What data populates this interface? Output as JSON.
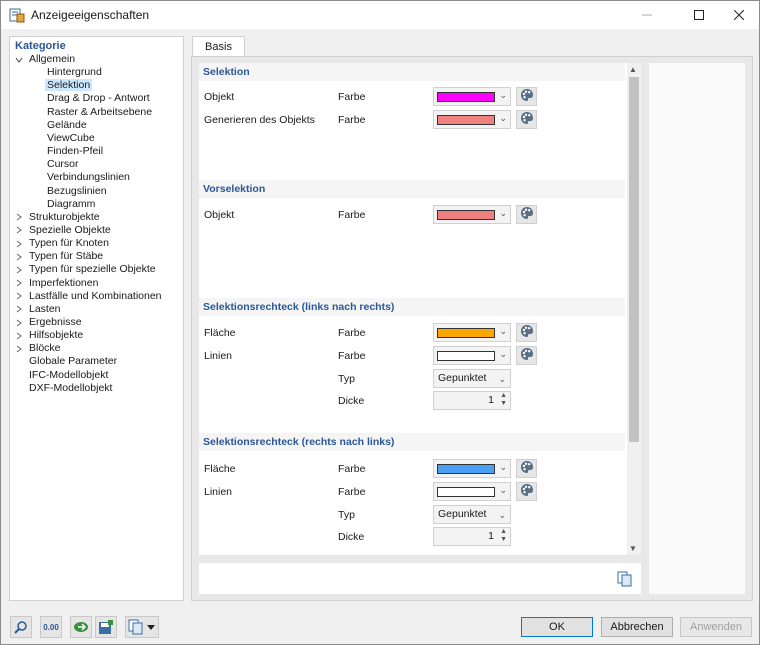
{
  "window": {
    "title": "Anzeigeeigenschaften"
  },
  "category": {
    "header": "Kategorie",
    "items": [
      {
        "label": "Allgemein",
        "level": 0,
        "expander": "open"
      },
      {
        "label": "Hintergrund",
        "level": 2
      },
      {
        "label": "Selektion",
        "level": 2,
        "selected": true
      },
      {
        "label": "Drag & Drop - Antwort",
        "level": 2
      },
      {
        "label": "Raster & Arbeitsebene",
        "level": 2
      },
      {
        "label": "Gelände",
        "level": 2
      },
      {
        "label": "ViewCube",
        "level": 2
      },
      {
        "label": "Finden-Pfeil",
        "level": 2
      },
      {
        "label": "Cursor",
        "level": 2
      },
      {
        "label": "Verbindungslinien",
        "level": 2
      },
      {
        "label": "Bezugslinien",
        "level": 2
      },
      {
        "label": "Diagramm",
        "level": 2
      },
      {
        "label": "Strukturobjekte",
        "level": 0,
        "expander": "closed"
      },
      {
        "label": "Spezielle Objekte",
        "level": 0,
        "expander": "closed"
      },
      {
        "label": "Typen für Knoten",
        "level": 0,
        "expander": "closed"
      },
      {
        "label": "Typen für Stäbe",
        "level": 0,
        "expander": "closed"
      },
      {
        "label": "Typen für spezielle Objekte",
        "level": 0,
        "expander": "closed"
      },
      {
        "label": "Imperfektionen",
        "level": 0,
        "expander": "closed"
      },
      {
        "label": "Lastfälle und Kombinationen",
        "level": 0,
        "expander": "closed"
      },
      {
        "label": "Lasten",
        "level": 0,
        "expander": "closed"
      },
      {
        "label": "Ergebnisse",
        "level": 0,
        "expander": "closed"
      },
      {
        "label": "Hilfsobjekte",
        "level": 0,
        "expander": "closed"
      },
      {
        "label": "Blöcke",
        "level": 0,
        "expander": "closed"
      },
      {
        "label": "Globale Parameter",
        "level": 0
      },
      {
        "label": "IFC-Modellobjekt",
        "level": 0
      },
      {
        "label": "DXF-Modellobjekt",
        "level": 0
      }
    ]
  },
  "tab": {
    "label": "Basis"
  },
  "sections": {
    "selektion": {
      "title": "Selektion",
      "rows": [
        {
          "label": "Objekt",
          "prop": "Farbe",
          "color": "#ff00ff"
        },
        {
          "label": "Generieren des Objekts",
          "prop": "Farbe",
          "color": "#f08080"
        }
      ]
    },
    "vorselektion": {
      "title": "Vorselektion",
      "rows": [
        {
          "label": "Objekt",
          "prop": "Farbe",
          "color": "#f08080"
        }
      ]
    },
    "rect_lr": {
      "title": "Selektionsrechteck (links nach rechts)",
      "flaeche": {
        "label": "Fläche",
        "prop": "Farbe",
        "color": "#ffa500"
      },
      "linien": {
        "label": "Linien",
        "prop": "Farbe",
        "color": "#ffffff"
      },
      "typ": {
        "label": "Typ",
        "value": "Gepunktet"
      },
      "dicke": {
        "label": "Dicke",
        "value": "1"
      }
    },
    "rect_rl": {
      "title": "Selektionsrechteck (rechts nach links)",
      "flaeche": {
        "label": "Fläche",
        "prop": "Farbe",
        "color": "#4a9ff5"
      },
      "linien": {
        "label": "Linien",
        "prop": "Farbe",
        "color": "#ffffff"
      },
      "typ": {
        "label": "Typ",
        "value": "Gepunktet"
      },
      "dicke": {
        "label": "Dicke",
        "value": "1"
      }
    }
  },
  "footer": {
    "ok": "OK",
    "cancel": "Abbrechen",
    "apply": "Anwenden",
    "number_btn": "0.00"
  }
}
